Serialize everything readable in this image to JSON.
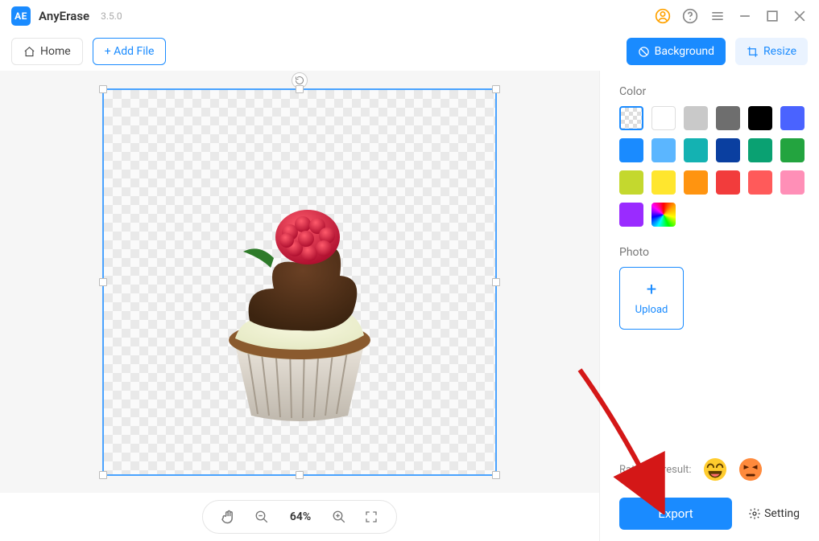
{
  "app": {
    "name": "AnyErase",
    "version": "3.5.0",
    "logo_text": "AE"
  },
  "toolbar": {
    "home_label": "Home",
    "add_file_label": "+ Add File",
    "background_label": "Background",
    "resize_label": "Resize"
  },
  "canvas": {
    "zoom_label": "64%"
  },
  "side": {
    "color_label": "Color",
    "photo_label": "Photo",
    "upload_label": "Upload",
    "rate_label": "Rate this result:",
    "export_label": "Export",
    "setting_label": "Setting",
    "colors": [
      {
        "name": "transparent",
        "value": "transparent"
      },
      {
        "name": "white",
        "value": "#ffffff",
        "bordered": true
      },
      {
        "name": "light-gray",
        "value": "#c9c9c9"
      },
      {
        "name": "gray",
        "value": "#6e6e6e"
      },
      {
        "name": "black",
        "value": "#000000"
      },
      {
        "name": "royal-blue",
        "value": "#4a63ff"
      },
      {
        "name": "blue",
        "value": "#1a8bff"
      },
      {
        "name": "sky-blue",
        "value": "#5bb6ff"
      },
      {
        "name": "teal",
        "value": "#14b2b2"
      },
      {
        "name": "navy",
        "value": "#0a3fa0"
      },
      {
        "name": "emerald",
        "value": "#0aa172"
      },
      {
        "name": "green",
        "value": "#23a43f"
      },
      {
        "name": "lime",
        "value": "#c4d82e"
      },
      {
        "name": "yellow",
        "value": "#ffe62e"
      },
      {
        "name": "orange",
        "value": "#ff9410"
      },
      {
        "name": "red",
        "value": "#f23c3c"
      },
      {
        "name": "coral",
        "value": "#ff5a5a"
      },
      {
        "name": "pink",
        "value": "#ff8fb7"
      },
      {
        "name": "purple",
        "value": "#9a2bff"
      },
      {
        "name": "rainbow",
        "value": "rainbow"
      }
    ]
  }
}
